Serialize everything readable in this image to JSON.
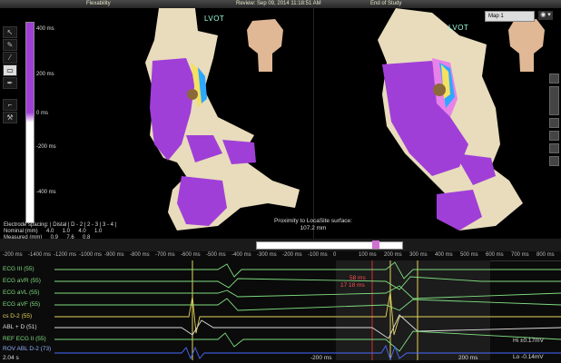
{
  "topbar": {
    "left": "Flexability",
    "center": "Review: Sep 09, 2014 11:18:51 AM",
    "right": "End of Study"
  },
  "map_left": {
    "label": "LVOT"
  },
  "map_right": {
    "label": "LVOT",
    "map_selector": "Map 1",
    "eye": "◉ ▾"
  },
  "scale": {
    "t400": "400 ms",
    "t200": "200 ms",
    "t0": "0 ms",
    "tm200": "-200 ms",
    "tm400": "-400 ms"
  },
  "electrode_table": {
    "header": "Electrode spacing: | Distal | D - 2 | 2 - 3 | 3 - 4 |",
    "nominal_label": "Nominal (mm)",
    "nominal": [
      "4.0",
      "1.0",
      "4.0",
      "1.0"
    ],
    "measured_label": "Measured (mm)",
    "measured": [
      "0.9",
      "7.6",
      "0.8"
    ]
  },
  "proximity": {
    "label": "Proximity to LocaSite surface:",
    "value": "107.2 mm"
  },
  "timeline": {
    "labels": [
      "-200 ms",
      "-1400 ms",
      "-1200 ms",
      "-1000 ms",
      "-900 ms",
      "-800 ms",
      "-700 ms",
      "-600 ms",
      "-500 ms",
      "-400 ms",
      "-300 ms",
      "-200 ms",
      "-100 ms",
      "0",
      "100 ms",
      "200 ms",
      "300 ms",
      "400 ms",
      "500 ms",
      "600 ms",
      "700 ms",
      "800 ms"
    ]
  },
  "channels": [
    {
      "label": "ECG III (55)",
      "color": "#7fdc7f"
    },
    {
      "label": "ECG aVR (55)",
      "color": "#7fdc7f"
    },
    {
      "label": "ECG aVL (55)",
      "color": "#7fdc7f"
    },
    {
      "label": "ECG aVF (55)",
      "color": "#7fdc7f"
    },
    {
      "label": "cs  D-2 (55)",
      "color": "#e4d45a"
    },
    {
      "label": "ABL + D (51)",
      "color": "#ddd"
    },
    {
      "label": "REF ECG II (55)",
      "color": "#7fdc7f"
    },
    {
      "label": "ROV ABL  D-2 (73)",
      "color": "#8fb0ff"
    }
  ],
  "annotations": {
    "interval": "58 ms",
    "interval2": "17 18 ms"
  },
  "footer": {
    "speed": "2.04 s",
    "m200": "-200 ms",
    "p200": "200 ms",
    "hi": "Hi ±0.17mV",
    "lo": "Lo -0.14mV"
  },
  "colors": {
    "purple": "#a03fd8",
    "tissue": "#e8dcbc",
    "ecg_green": "#7fdc7f"
  }
}
